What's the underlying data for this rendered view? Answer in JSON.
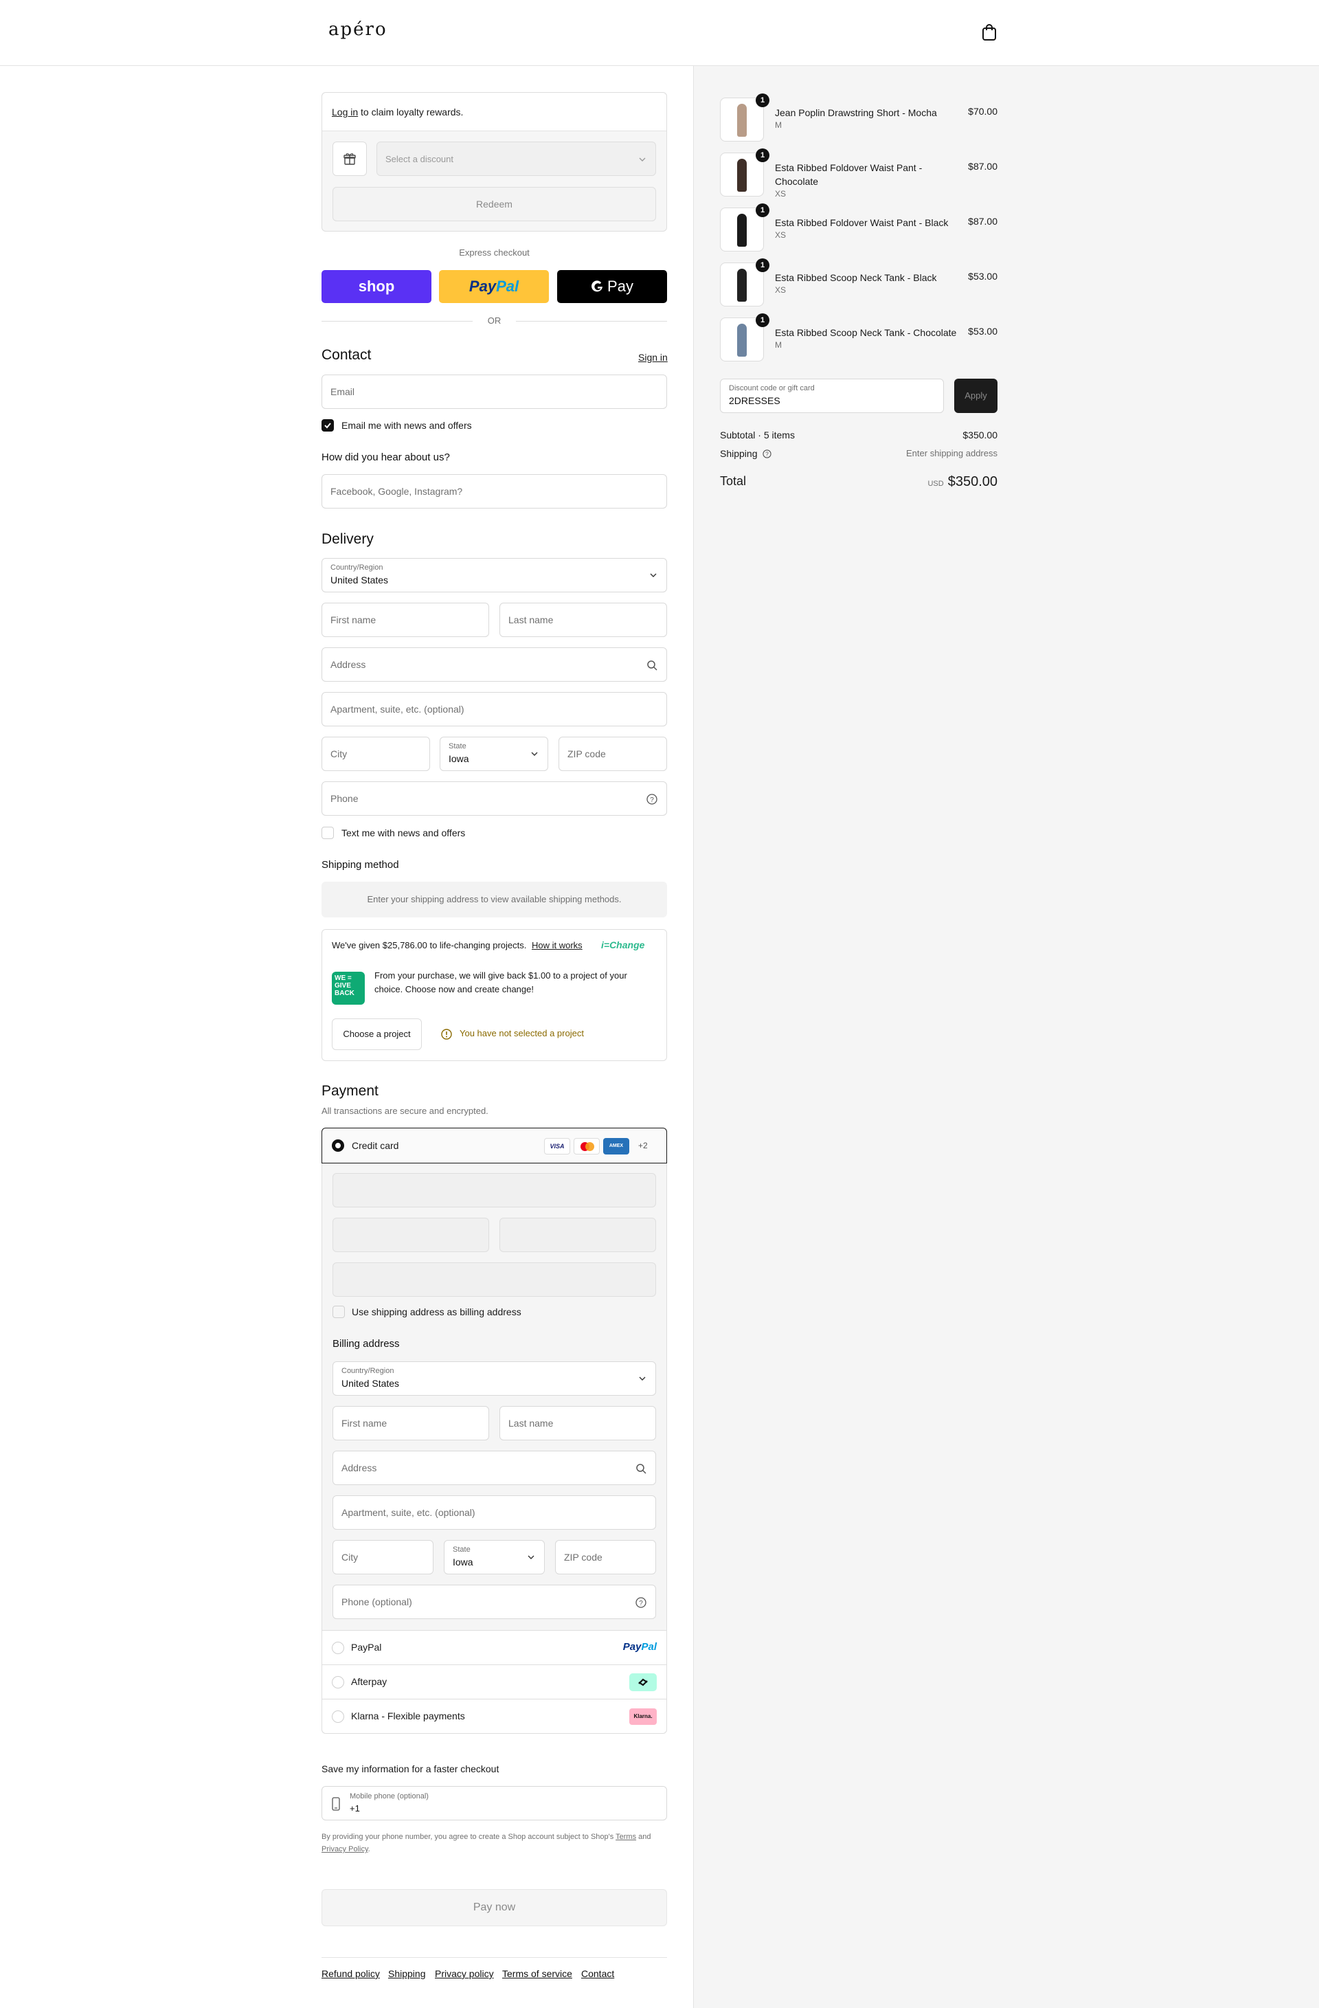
{
  "header": {
    "logo": "apéro"
  },
  "loyalty": {
    "login_link": "Log in",
    "login_rest": " to claim loyalty rewards.",
    "discount_placeholder": "Select a discount",
    "redeem_label": "Redeem"
  },
  "express": {
    "label": "Express checkout",
    "shop": "shop",
    "paypal_a": "Pay",
    "paypal_b": "Pal",
    "gpay": "Pay",
    "or": "OR"
  },
  "contact": {
    "title": "Contact",
    "signin": "Sign in",
    "email_placeholder": "Email",
    "news_label": "Email me with news and offers",
    "news_checked": true,
    "hear_label": "How did you hear about us?",
    "hear_placeholder": "Facebook, Google, Instagram?"
  },
  "delivery": {
    "title": "Delivery",
    "country_label": "Country/Region",
    "country": "United States",
    "first_name": "First name",
    "last_name": "Last name",
    "address": "Address",
    "apartment": "Apartment, suite, etc. (optional)",
    "city": "City",
    "state_label": "State",
    "state": "Iowa",
    "zip": "ZIP code",
    "phone": "Phone",
    "text_label": "Text me with news and offers"
  },
  "shipping": {
    "title": "Shipping method",
    "notice": "Enter your shipping address to view available shipping methods."
  },
  "give": {
    "headline": "We've given $25,786.00 to life-changing projects.",
    "how": "How it works",
    "brand": "i=Change",
    "badge": "WE = GIVE BACK",
    "text": "From your purchase, we will give back $1.00 to a project of your choice. Choose now and create change!",
    "choose": "Choose a project",
    "warning": "You have not selected a project"
  },
  "payment": {
    "title": "Payment",
    "subtitle": "All transactions are secure and encrypted.",
    "credit": "Credit card",
    "cards": {
      "visa": "VISA",
      "amex": "AMEX",
      "more": "+2"
    },
    "billing_same": "Use shipping address as billing address",
    "billing_title": "Billing address",
    "country_label": "Country/Region",
    "country": "United States",
    "first_name": "First name",
    "last_name": "Last name",
    "address": "Address",
    "apartment": "Apartment, suite, etc. (optional)",
    "city": "City",
    "state_label": "State",
    "state": "Iowa",
    "zip": "ZIP code",
    "phone": "Phone (optional)",
    "paypal": "PayPal",
    "paypal_logo_a": "Pay",
    "paypal_logo_b": "Pal",
    "afterpay": "Afterpay",
    "klarna": "Klarna - Flexible payments",
    "klarna_logo": "Klarna."
  },
  "save": {
    "title": "Save my information for a faster checkout",
    "mobile_label": "Mobile phone (optional)",
    "mobile_value": "+1",
    "legal_a": "By providing your phone number, you agree to create a Shop account subject to Shop's ",
    "terms": "Terms",
    "legal_b": " and ",
    "privacy": "Privacy Policy",
    "legal_c": "."
  },
  "pay_now": "Pay now",
  "footer": {
    "refund": "Refund policy",
    "shipping": "Shipping",
    "privacy": "Privacy policy",
    "terms": "Terms of service",
    "contact": "Contact"
  },
  "summary": {
    "items": [
      {
        "name": "Jean Poplin Drawstring Short - Mocha",
        "variant": "M",
        "price": "$70.00",
        "qty": "1",
        "color": "#b89c88"
      },
      {
        "name": "Esta Ribbed Foldover Waist Pant - Chocolate",
        "variant": "XS",
        "price": "$87.00",
        "qty": "1",
        "color": "#3f2f28"
      },
      {
        "name": "Esta Ribbed Foldover Waist Pant - Black",
        "variant": "XS",
        "price": "$87.00",
        "qty": "1",
        "color": "#1b1b1b"
      },
      {
        "name": "Esta Ribbed Scoop Neck Tank - Black",
        "variant": "XS",
        "price": "$53.00",
        "qty": "1",
        "color": "#222222"
      },
      {
        "name": "Esta Ribbed Scoop Neck Tank - Chocolate",
        "variant": "M",
        "price": "$53.00",
        "qty": "1",
        "color": "#6d84a0"
      }
    ],
    "code_label": "Discount code or gift card",
    "code_value": "2DRESSES",
    "apply": "Apply",
    "subtotal_label": "Subtotal · 5 items",
    "subtotal": "$350.00",
    "shipping_label": "Shipping",
    "shipping_value": "Enter shipping address",
    "total_label": "Total",
    "currency": "USD",
    "total": "$350.00"
  }
}
